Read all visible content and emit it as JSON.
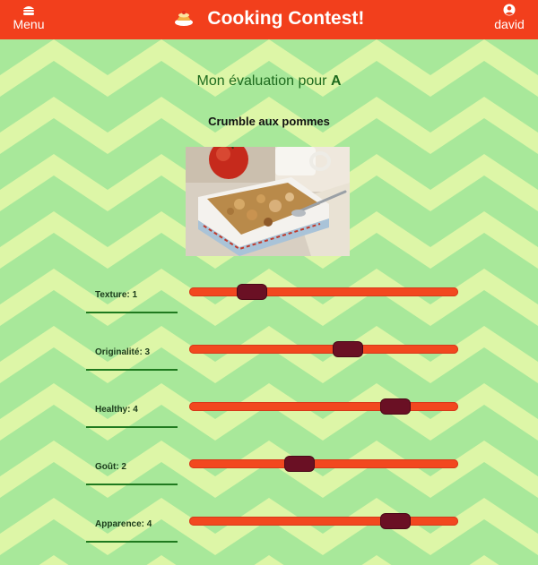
{
  "header": {
    "menu_label": "Menu",
    "title": "Cooking Contest!",
    "user_label": "david",
    "colors": {
      "bar": "#f23f1c",
      "text": "#ffffff"
    }
  },
  "evaluation": {
    "title_prefix": "Mon évaluation pour",
    "contestant": "A",
    "dish_name": "Crumble aux pommes"
  },
  "criteria": [
    {
      "label": "Texture: 1",
      "value": 1,
      "min": 0,
      "max": 5
    },
    {
      "label": "Originalité: 3",
      "value": 3,
      "min": 0,
      "max": 5
    },
    {
      "label": "Healthy: 4",
      "value": 4,
      "min": 0,
      "max": 5
    },
    {
      "label": "Goût: 2",
      "value": 2,
      "min": 0,
      "max": 5
    },
    {
      "label": "Apparence: 4",
      "value": 4,
      "min": 0,
      "max": 5
    }
  ],
  "colors": {
    "background_light": "#ddf6a7",
    "background_stripe": "#a8e89a",
    "slider_track": "#f2481f",
    "slider_thumb": "#6a1024",
    "title_green": "#1e6b1e"
  }
}
